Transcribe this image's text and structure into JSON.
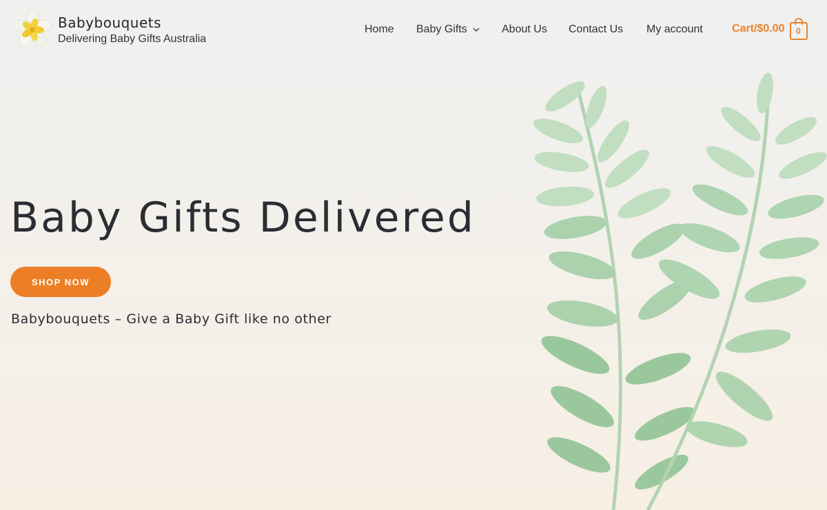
{
  "site": {
    "title": "Babybouquets",
    "tagline": "Delivering Baby Gifts Australia",
    "logo_icon": "frangipani-flower-icon"
  },
  "nav": {
    "items": [
      {
        "label": "Home"
      },
      {
        "label": "Baby Gifts",
        "has_dropdown": true
      },
      {
        "label": "About Us"
      },
      {
        "label": "Contact Us"
      },
      {
        "label": "My account"
      }
    ],
    "dropdown_icon": "chevron-down-icon"
  },
  "cart": {
    "label": "Cart/$0.00",
    "count": "0",
    "icon": "shopping-bag-icon"
  },
  "hero": {
    "title": "Baby Gifts Delivered",
    "button_label": "SHOP NOW",
    "subtitle": "Babybouquets – Give a Baby Gift like no other",
    "decoration_icon": "watercolor-leaves-illustration"
  },
  "colors": {
    "accent": "#ec7f25",
    "cart_accent": "#e9822e",
    "text": "#2b2d33",
    "background_top": "#f0f0ef",
    "background_bottom": "#f7efe4",
    "leaf_green": "#8fc295"
  }
}
